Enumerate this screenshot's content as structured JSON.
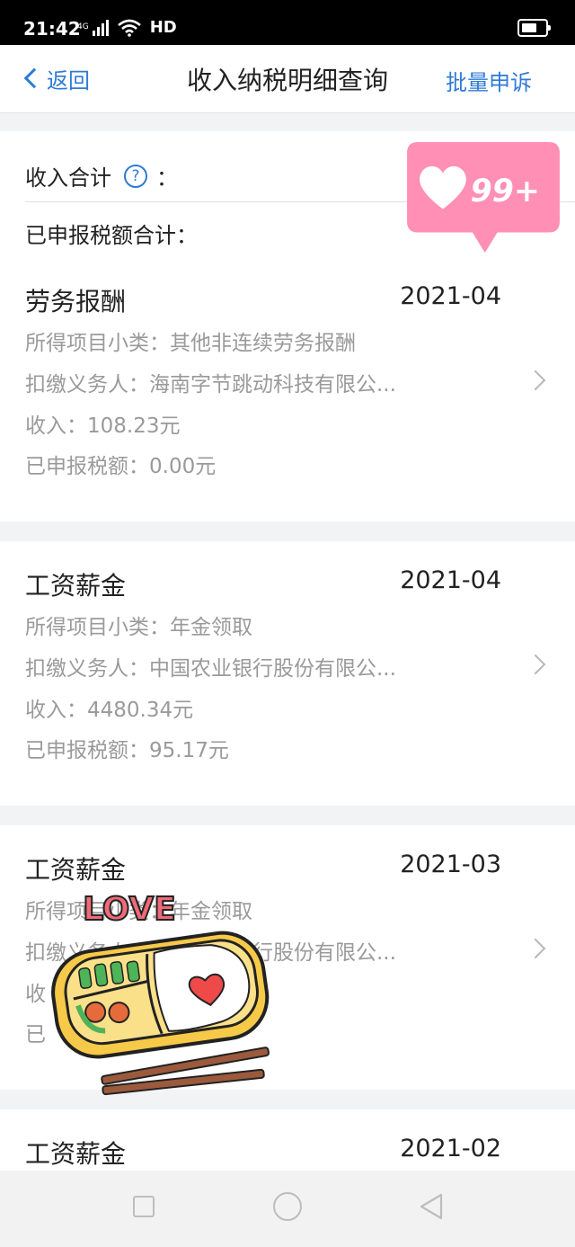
{
  "status_bar": {
    "time": "21:42",
    "network": "4G",
    "hd": "HD"
  },
  "nav": {
    "back_label": "返回",
    "title": "收入纳税明细查询",
    "action_label": "批量申诉"
  },
  "summary": {
    "income_total_label": "收入合计",
    "help_icon": "?",
    "colon": "：",
    "tax_total_label": "已申报税额合计："
  },
  "sticker_badge": {
    "text": "99+"
  },
  "sticker_lunch": {
    "text": "LOVE"
  },
  "records": [
    {
      "title": "劳务报酬",
      "date": "2021-04",
      "subcategory": "所得项目小类：其他非连续劳务报酬",
      "withholder": "扣缴义务人：海南字节跳动科技有限公...",
      "income": "收入：108.23元",
      "tax": "已申报税额：0.00元"
    },
    {
      "title": "工资薪金",
      "date": "2021-04",
      "subcategory": "所得项目小类：年金领取",
      "withholder": "扣缴义务人：中国农业银行股份有限公...",
      "income": "收入：4480.34元",
      "tax": "已申报税额：95.17元"
    },
    {
      "title": "工资薪金",
      "date": "2021-03",
      "subcategory": "所得项目小类：年金领取",
      "withholder": "扣缴义务人：中国农业银行股份有限公...",
      "income": "收",
      "tax": "已"
    },
    {
      "title": "工资薪金",
      "date": "2021-02"
    }
  ],
  "colors": {
    "accent": "#2f7bd6",
    "badge_pink": "#ff8fb5"
  }
}
